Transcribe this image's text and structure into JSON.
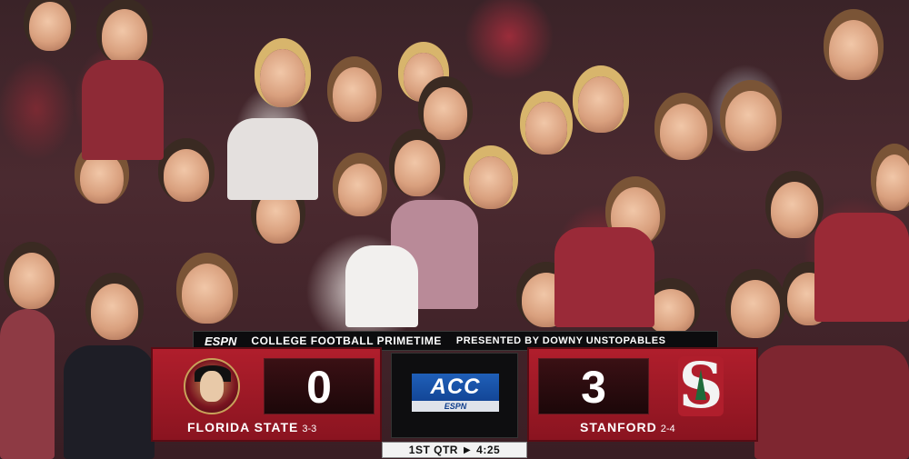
{
  "broadcast": {
    "network": "ESPN",
    "show_title": "COLLEGE FOOTBALL PRIMETIME",
    "sponsor": "PRESENTED BY DOWNY UNSTOPABLES"
  },
  "scorebug": {
    "home": {
      "name": "FLORIDA STATE",
      "record": "3-3",
      "score": "0",
      "color": "#b01e2c",
      "logo_icon": "seminole-head-icon"
    },
    "away": {
      "name": "STANFORD",
      "record": "2-4",
      "score": "3",
      "color": "#b01e2c",
      "logo_icon": "stanford-s-tree-icon"
    },
    "conference": {
      "name": "ACC",
      "network": "ESPN",
      "accent": "#1f5fb8"
    },
    "clock": {
      "period": "1ST QTR",
      "time": "4:25"
    }
  }
}
